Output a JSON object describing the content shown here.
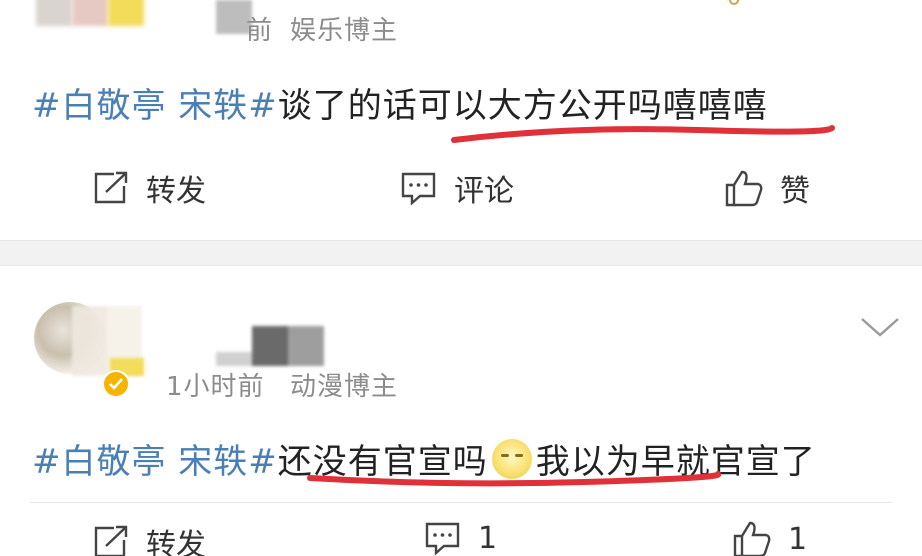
{
  "posts": [
    {
      "meta": {
        "time": "前",
        "category": "娱乐博主"
      },
      "content": {
        "tag": "#白敬亭 宋轶#",
        "text_before": "谈了的话可以",
        "text_underlined": "大方公开吗嘻嘻嘻"
      },
      "actions": {
        "repost": "转发",
        "comment": "评论",
        "like": "赞"
      }
    },
    {
      "meta": {
        "time": "1小时前",
        "category": "动漫博主"
      },
      "content": {
        "tag": "#白敬亭 宋轶#",
        "text_before": "还没有官宣吗",
        "emoji": "moon-face-emoji",
        "text_after": "我以为早就官宣了"
      },
      "actions": {
        "repost": "转发",
        "comment_count": "1",
        "like_count": "1"
      }
    }
  ],
  "icons": [
    "repost-icon",
    "comment-icon",
    "like-icon",
    "chevron-down-icon",
    "verified-badge-icon"
  ],
  "colors": {
    "hashtag": "#4a7fb5",
    "underline": "#e0303a",
    "meta": "#8c8c8c",
    "verified": "#f5b400"
  }
}
